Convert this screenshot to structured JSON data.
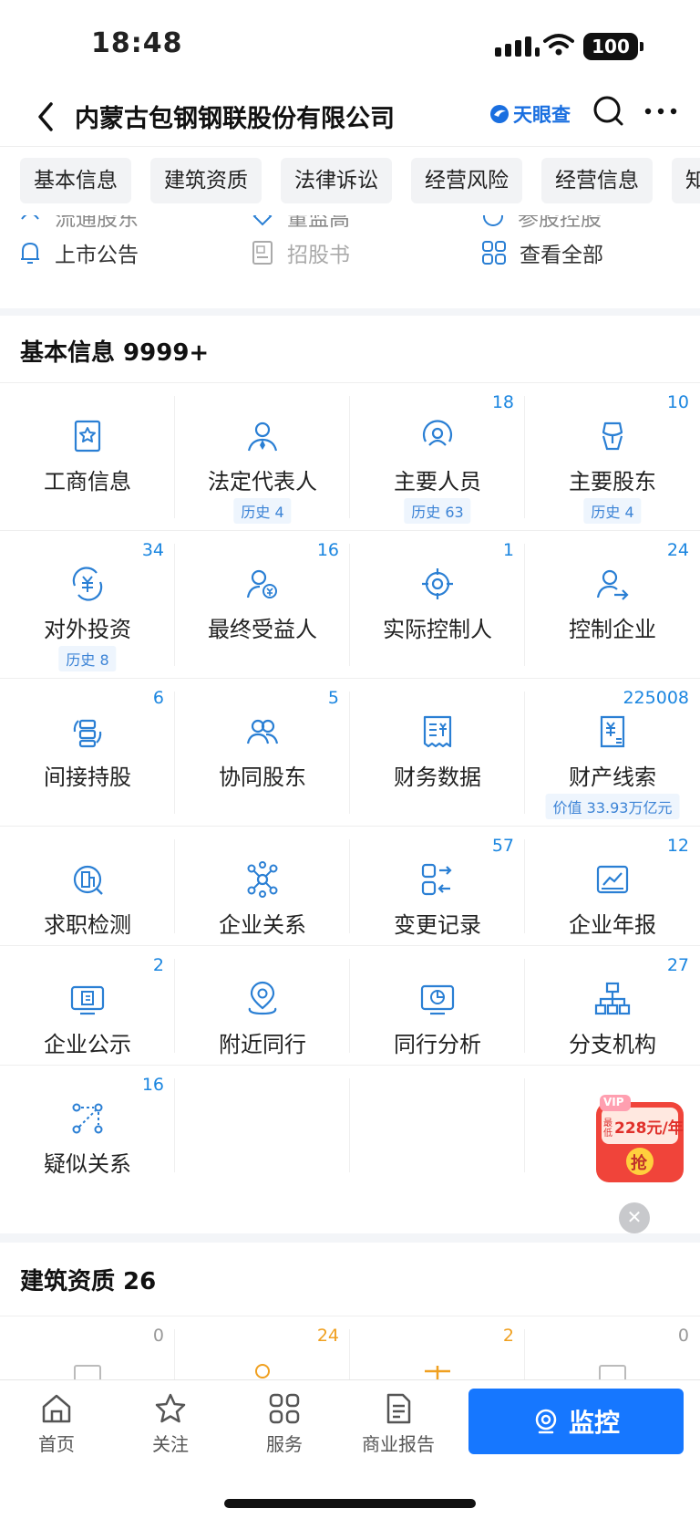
{
  "status_bar": {
    "time": "18:48",
    "battery": "100"
  },
  "nav": {
    "title": "内蒙古包钢钢联股份有限公司",
    "brand": "天眼查"
  },
  "tabs": [
    "基本信息",
    "建筑资质",
    "法律诉讼",
    "经营风险",
    "经营信息",
    "知"
  ],
  "quick_partial": [
    "流通股东",
    "董监高",
    "参股控股"
  ],
  "quick_links": [
    {
      "label": "上市公告",
      "icon": "bell-icon",
      "disabled": false
    },
    {
      "label": "招股书",
      "icon": "prospectus-icon",
      "disabled": true
    },
    {
      "label": "查看全部",
      "icon": "grid-icon",
      "disabled": false
    }
  ],
  "basic_info": {
    "title": "基本信息 9999+",
    "items": [
      {
        "label": "工商信息",
        "count": "",
        "badge": "",
        "icon": "certificate-star-icon"
      },
      {
        "label": "法定代表人",
        "count": "",
        "badge": "历史 4",
        "icon": "person-tie-icon"
      },
      {
        "label": "主要人员",
        "count": "18",
        "badge": "历史 63",
        "icon": "person-circle-icon"
      },
      {
        "label": "主要股东",
        "count": "10",
        "badge": "历史 4",
        "icon": "shareholder-icon"
      },
      {
        "label": "对外投资",
        "count": "34",
        "badge": "历史 8",
        "icon": "yen-cycle-icon"
      },
      {
        "label": "最终受益人",
        "count": "16",
        "badge": "",
        "icon": "person-yen-icon"
      },
      {
        "label": "实际控制人",
        "count": "1",
        "badge": "",
        "icon": "target-icon"
      },
      {
        "label": "控制企业",
        "count": "24",
        "badge": "",
        "icon": "person-arrow-icon"
      },
      {
        "label": "间接持股",
        "count": "6",
        "badge": "",
        "icon": "layers-cycle-icon"
      },
      {
        "label": "协同股东",
        "count": "5",
        "badge": "",
        "icon": "two-persons-icon"
      },
      {
        "label": "财务数据",
        "count": "",
        "badge": "",
        "icon": "invoice-yen-icon"
      },
      {
        "label": "财产线索",
        "count": "225008",
        "badge": "价值 33.93万亿元",
        "icon": "document-yen-icon"
      },
      {
        "label": "求职检测",
        "count": "",
        "badge": "",
        "icon": "building-search-icon"
      },
      {
        "label": "企业关系",
        "count": "",
        "badge": "",
        "icon": "network-icon"
      },
      {
        "label": "变更记录",
        "count": "57",
        "badge": "",
        "icon": "change-record-icon"
      },
      {
        "label": "企业年报",
        "count": "12",
        "badge": "",
        "icon": "chart-report-icon"
      },
      {
        "label": "企业公示",
        "count": "2",
        "badge": "",
        "icon": "monitor-doc-icon"
      },
      {
        "label": "附近同行",
        "count": "",
        "badge": "",
        "icon": "location-icon"
      },
      {
        "label": "同行分析",
        "count": "",
        "badge": "",
        "icon": "monitor-pie-icon"
      },
      {
        "label": "分支机构",
        "count": "27",
        "badge": "",
        "icon": "org-tree-icon"
      },
      {
        "label": "疑似关系",
        "count": "16",
        "badge": "",
        "icon": "dotted-link-icon"
      }
    ]
  },
  "construction": {
    "title": "建筑资质 26",
    "counts": [
      "0",
      "24",
      "2",
      "0"
    ]
  },
  "promo": {
    "vip": "VIP",
    "price": "228元/年",
    "action": "抢",
    "prefix": "最低"
  },
  "bottom_nav": [
    {
      "label": "首页",
      "icon": "home-icon"
    },
    {
      "label": "关注",
      "icon": "star-icon"
    },
    {
      "label": "服务",
      "icon": "services-icon"
    },
    {
      "label": "商业报告",
      "icon": "report-icon"
    }
  ],
  "monitor_button": "监控",
  "colors": {
    "accent": "#1677ff",
    "count_blue": "#1b86e0",
    "icon_blue": "#2a7fd4",
    "orange": "#f0a020"
  }
}
